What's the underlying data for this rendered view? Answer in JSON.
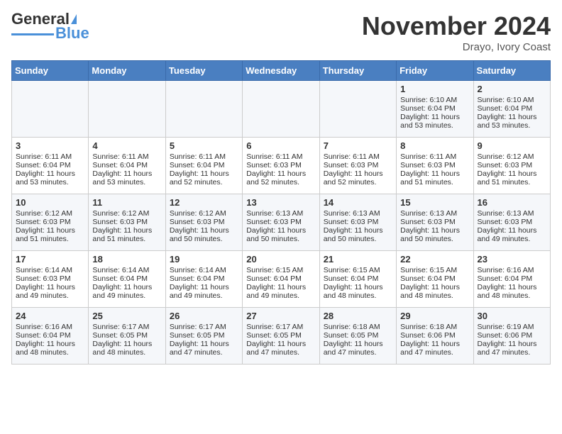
{
  "header": {
    "logo_general": "General",
    "logo_blue": "Blue",
    "month_title": "November 2024",
    "location": "Drayo, Ivory Coast"
  },
  "days_of_week": [
    "Sunday",
    "Monday",
    "Tuesday",
    "Wednesday",
    "Thursday",
    "Friday",
    "Saturday"
  ],
  "weeks": [
    [
      {
        "day": "",
        "sunrise": "",
        "sunset": "",
        "daylight": ""
      },
      {
        "day": "",
        "sunrise": "",
        "sunset": "",
        "daylight": ""
      },
      {
        "day": "",
        "sunrise": "",
        "sunset": "",
        "daylight": ""
      },
      {
        "day": "",
        "sunrise": "",
        "sunset": "",
        "daylight": ""
      },
      {
        "day": "",
        "sunrise": "",
        "sunset": "",
        "daylight": ""
      },
      {
        "day": "1",
        "sunrise": "Sunrise: 6:10 AM",
        "sunset": "Sunset: 6:04 PM",
        "daylight": "Daylight: 11 hours and 53 minutes."
      },
      {
        "day": "2",
        "sunrise": "Sunrise: 6:10 AM",
        "sunset": "Sunset: 6:04 PM",
        "daylight": "Daylight: 11 hours and 53 minutes."
      }
    ],
    [
      {
        "day": "3",
        "sunrise": "Sunrise: 6:11 AM",
        "sunset": "Sunset: 6:04 PM",
        "daylight": "Daylight: 11 hours and 53 minutes."
      },
      {
        "day": "4",
        "sunrise": "Sunrise: 6:11 AM",
        "sunset": "Sunset: 6:04 PM",
        "daylight": "Daylight: 11 hours and 53 minutes."
      },
      {
        "day": "5",
        "sunrise": "Sunrise: 6:11 AM",
        "sunset": "Sunset: 6:04 PM",
        "daylight": "Daylight: 11 hours and 52 minutes."
      },
      {
        "day": "6",
        "sunrise": "Sunrise: 6:11 AM",
        "sunset": "Sunset: 6:03 PM",
        "daylight": "Daylight: 11 hours and 52 minutes."
      },
      {
        "day": "7",
        "sunrise": "Sunrise: 6:11 AM",
        "sunset": "Sunset: 6:03 PM",
        "daylight": "Daylight: 11 hours and 52 minutes."
      },
      {
        "day": "8",
        "sunrise": "Sunrise: 6:11 AM",
        "sunset": "Sunset: 6:03 PM",
        "daylight": "Daylight: 11 hours and 51 minutes."
      },
      {
        "day": "9",
        "sunrise": "Sunrise: 6:12 AM",
        "sunset": "Sunset: 6:03 PM",
        "daylight": "Daylight: 11 hours and 51 minutes."
      }
    ],
    [
      {
        "day": "10",
        "sunrise": "Sunrise: 6:12 AM",
        "sunset": "Sunset: 6:03 PM",
        "daylight": "Daylight: 11 hours and 51 minutes."
      },
      {
        "day": "11",
        "sunrise": "Sunrise: 6:12 AM",
        "sunset": "Sunset: 6:03 PM",
        "daylight": "Daylight: 11 hours and 51 minutes."
      },
      {
        "day": "12",
        "sunrise": "Sunrise: 6:12 AM",
        "sunset": "Sunset: 6:03 PM",
        "daylight": "Daylight: 11 hours and 50 minutes."
      },
      {
        "day": "13",
        "sunrise": "Sunrise: 6:13 AM",
        "sunset": "Sunset: 6:03 PM",
        "daylight": "Daylight: 11 hours and 50 minutes."
      },
      {
        "day": "14",
        "sunrise": "Sunrise: 6:13 AM",
        "sunset": "Sunset: 6:03 PM",
        "daylight": "Daylight: 11 hours and 50 minutes."
      },
      {
        "day": "15",
        "sunrise": "Sunrise: 6:13 AM",
        "sunset": "Sunset: 6:03 PM",
        "daylight": "Daylight: 11 hours and 50 minutes."
      },
      {
        "day": "16",
        "sunrise": "Sunrise: 6:13 AM",
        "sunset": "Sunset: 6:03 PM",
        "daylight": "Daylight: 11 hours and 49 minutes."
      }
    ],
    [
      {
        "day": "17",
        "sunrise": "Sunrise: 6:14 AM",
        "sunset": "Sunset: 6:03 PM",
        "daylight": "Daylight: 11 hours and 49 minutes."
      },
      {
        "day": "18",
        "sunrise": "Sunrise: 6:14 AM",
        "sunset": "Sunset: 6:04 PM",
        "daylight": "Daylight: 11 hours and 49 minutes."
      },
      {
        "day": "19",
        "sunrise": "Sunrise: 6:14 AM",
        "sunset": "Sunset: 6:04 PM",
        "daylight": "Daylight: 11 hours and 49 minutes."
      },
      {
        "day": "20",
        "sunrise": "Sunrise: 6:15 AM",
        "sunset": "Sunset: 6:04 PM",
        "daylight": "Daylight: 11 hours and 49 minutes."
      },
      {
        "day": "21",
        "sunrise": "Sunrise: 6:15 AM",
        "sunset": "Sunset: 6:04 PM",
        "daylight": "Daylight: 11 hours and 48 minutes."
      },
      {
        "day": "22",
        "sunrise": "Sunrise: 6:15 AM",
        "sunset": "Sunset: 6:04 PM",
        "daylight": "Daylight: 11 hours and 48 minutes."
      },
      {
        "day": "23",
        "sunrise": "Sunrise: 6:16 AM",
        "sunset": "Sunset: 6:04 PM",
        "daylight": "Daylight: 11 hours and 48 minutes."
      }
    ],
    [
      {
        "day": "24",
        "sunrise": "Sunrise: 6:16 AM",
        "sunset": "Sunset: 6:04 PM",
        "daylight": "Daylight: 11 hours and 48 minutes."
      },
      {
        "day": "25",
        "sunrise": "Sunrise: 6:17 AM",
        "sunset": "Sunset: 6:05 PM",
        "daylight": "Daylight: 11 hours and 48 minutes."
      },
      {
        "day": "26",
        "sunrise": "Sunrise: 6:17 AM",
        "sunset": "Sunset: 6:05 PM",
        "daylight": "Daylight: 11 hours and 47 minutes."
      },
      {
        "day": "27",
        "sunrise": "Sunrise: 6:17 AM",
        "sunset": "Sunset: 6:05 PM",
        "daylight": "Daylight: 11 hours and 47 minutes."
      },
      {
        "day": "28",
        "sunrise": "Sunrise: 6:18 AM",
        "sunset": "Sunset: 6:05 PM",
        "daylight": "Daylight: 11 hours and 47 minutes."
      },
      {
        "day": "29",
        "sunrise": "Sunrise: 6:18 AM",
        "sunset": "Sunset: 6:06 PM",
        "daylight": "Daylight: 11 hours and 47 minutes."
      },
      {
        "day": "30",
        "sunrise": "Sunrise: 6:19 AM",
        "sunset": "Sunset: 6:06 PM",
        "daylight": "Daylight: 11 hours and 47 minutes."
      }
    ]
  ]
}
